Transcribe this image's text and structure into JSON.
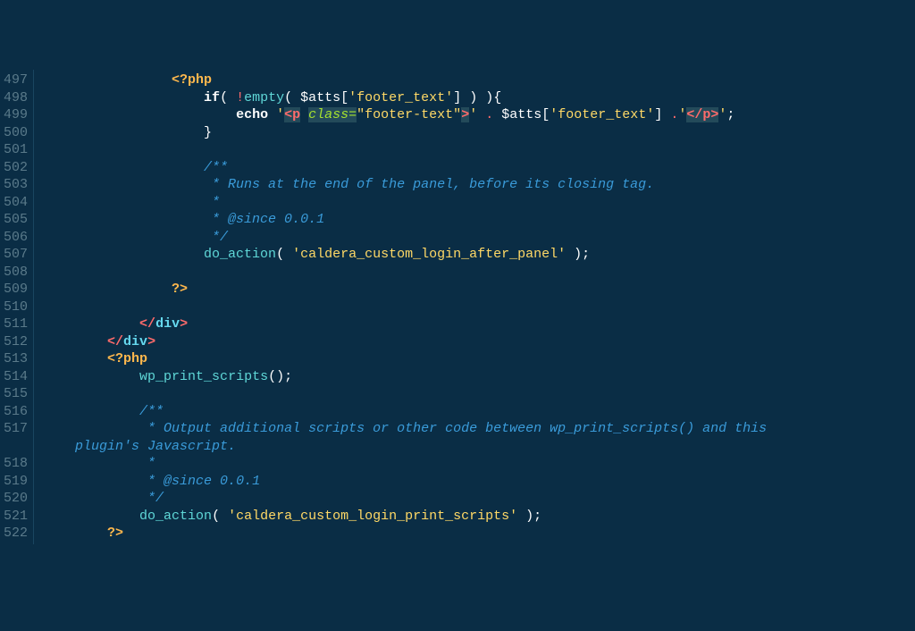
{
  "gutter": {
    "start": 497,
    "end": 522
  },
  "lines": {
    "l497": {
      "indent": "                ",
      "tokens": [
        {
          "cls": "php-tag",
          "t": "<?php"
        }
      ]
    },
    "l498": {
      "indent": "                    ",
      "tokens": [
        {
          "cls": "keyword",
          "t": "if"
        },
        {
          "cls": "paren",
          "t": "( "
        },
        {
          "cls": "op",
          "t": "!"
        },
        {
          "cls": "func",
          "t": "empty"
        },
        {
          "cls": "paren",
          "t": "( "
        },
        {
          "cls": "var",
          "t": "$atts"
        },
        {
          "cls": "bracket",
          "t": "["
        },
        {
          "cls": "string",
          "t": "'footer_text'"
        },
        {
          "cls": "bracket",
          "t": "]"
        },
        {
          "cls": "paren",
          "t": " ) )"
        },
        {
          "cls": "punct",
          "t": "{"
        }
      ]
    },
    "l499": {
      "indent": "                        ",
      "tokens": [
        {
          "cls": "keyword",
          "t": "echo"
        },
        {
          "cls": "",
          "t": " "
        },
        {
          "cls": "string",
          "t": "'"
        },
        {
          "cls": "tag-in-str",
          "t": "<p"
        },
        {
          "cls": "",
          "t": " "
        },
        {
          "cls": "attr-in-str",
          "t": "class="
        },
        {
          "cls": "val-in-str",
          "t": "\"footer-text\""
        },
        {
          "cls": "tag-in-str",
          "t": ">"
        },
        {
          "cls": "string",
          "t": "'"
        },
        {
          "cls": "",
          "t": " "
        },
        {
          "cls": "op",
          "t": "."
        },
        {
          "cls": "",
          "t": " "
        },
        {
          "cls": "var",
          "t": "$atts"
        },
        {
          "cls": "bracket",
          "t": "["
        },
        {
          "cls": "string",
          "t": "'footer_text'"
        },
        {
          "cls": "bracket",
          "t": "]"
        },
        {
          "cls": "",
          "t": " "
        },
        {
          "cls": "op",
          "t": "."
        },
        {
          "cls": "string",
          "t": "'"
        },
        {
          "cls": "tag-in-str",
          "t": "</p>"
        },
        {
          "cls": "string",
          "t": "'"
        },
        {
          "cls": "punct",
          "t": ";"
        }
      ]
    },
    "l500": {
      "indent": "                    ",
      "tokens": [
        {
          "cls": "punct",
          "t": "}"
        }
      ]
    },
    "l501": {
      "indent": "",
      "tokens": []
    },
    "l502": {
      "indent": "                    ",
      "tokens": [
        {
          "cls": "comment",
          "t": "/**"
        }
      ]
    },
    "l503": {
      "indent": "                     ",
      "tokens": [
        {
          "cls": "comment",
          "t": "* Runs at the end of the panel, before its closing tag."
        }
      ]
    },
    "l504": {
      "indent": "                     ",
      "tokens": [
        {
          "cls": "comment",
          "t": "*"
        }
      ]
    },
    "l505": {
      "indent": "                     ",
      "tokens": [
        {
          "cls": "comment",
          "t": "* @since 0.0.1"
        }
      ]
    },
    "l506": {
      "indent": "                     ",
      "tokens": [
        {
          "cls": "comment",
          "t": "*/"
        }
      ]
    },
    "l507": {
      "indent": "                    ",
      "tokens": [
        {
          "cls": "func",
          "t": "do_action"
        },
        {
          "cls": "paren",
          "t": "( "
        },
        {
          "cls": "string",
          "t": "'caldera_custom_login_after_panel'"
        },
        {
          "cls": "paren",
          "t": " )"
        },
        {
          "cls": "punct",
          "t": ";"
        }
      ]
    },
    "l508": {
      "indent": "",
      "tokens": []
    },
    "l509": {
      "indent": "                ",
      "tokens": [
        {
          "cls": "php-tag",
          "t": "?>"
        }
      ]
    },
    "l510": {
      "indent": "",
      "tokens": []
    },
    "l511": {
      "indent": "            ",
      "tokens": [
        {
          "cls": "tag",
          "t": "</"
        },
        {
          "cls": "tagname",
          "t": "div"
        },
        {
          "cls": "tag",
          "t": ">"
        }
      ]
    },
    "l512": {
      "indent": "        ",
      "tokens": [
        {
          "cls": "tag",
          "t": "</"
        },
        {
          "cls": "tagname",
          "t": "div"
        },
        {
          "cls": "tag",
          "t": ">"
        }
      ]
    },
    "l513": {
      "indent": "        ",
      "tokens": [
        {
          "cls": "php-tag",
          "t": "<?php"
        }
      ]
    },
    "l514": {
      "indent": "            ",
      "tokens": [
        {
          "cls": "func",
          "t": "wp_print_scripts"
        },
        {
          "cls": "paren",
          "t": "()"
        },
        {
          "cls": "punct",
          "t": ";"
        }
      ]
    },
    "l515": {
      "indent": "",
      "tokens": []
    },
    "l516": {
      "indent": "            ",
      "tokens": [
        {
          "cls": "comment",
          "t": "/**"
        }
      ]
    },
    "l517": {
      "indent": "             ",
      "tokens": [
        {
          "cls": "comment",
          "t": "* Output additional scripts or other code between wp_print_scripts() and this"
        }
      ]
    },
    "l517b": {
      "indent": "    ",
      "tokens": [
        {
          "cls": "comment",
          "t": "plugin's Javascript."
        }
      ]
    },
    "l518": {
      "indent": "             ",
      "tokens": [
        {
          "cls": "comment",
          "t": "*"
        }
      ]
    },
    "l519": {
      "indent": "             ",
      "tokens": [
        {
          "cls": "comment",
          "t": "* @since 0.0.1"
        }
      ]
    },
    "l520": {
      "indent": "             ",
      "tokens": [
        {
          "cls": "comment",
          "t": "*/"
        }
      ]
    },
    "l521": {
      "indent": "            ",
      "tokens": [
        {
          "cls": "func",
          "t": "do_action"
        },
        {
          "cls": "paren",
          "t": "( "
        },
        {
          "cls": "string",
          "t": "'caldera_custom_login_print_scripts'"
        },
        {
          "cls": "paren",
          "t": " )"
        },
        {
          "cls": "punct",
          "t": ";"
        }
      ]
    },
    "l522": {
      "indent": "        ",
      "tokens": [
        {
          "cls": "php-tag",
          "t": "?>"
        }
      ]
    }
  },
  "lineOrder": [
    "l497",
    "l498",
    "l499",
    "l500",
    "l501",
    "l502",
    "l503",
    "l504",
    "l505",
    "l506",
    "l507",
    "l508",
    "l509",
    "l510",
    "l511",
    "l512",
    "l513",
    "l514",
    "l515",
    "l516",
    "l517",
    "l517b",
    "l518",
    "l519",
    "l520",
    "l521",
    "l522"
  ],
  "gutterLabels": {
    "l497": "497",
    "l498": "498",
    "l499": "499",
    "l500": "500",
    "l501": "501",
    "l502": "502",
    "l503": "503",
    "l504": "504",
    "l505": "505",
    "l506": "506",
    "l507": "507",
    "l508": "508",
    "l509": "509",
    "l510": "510",
    "l511": "511",
    "l512": "512",
    "l513": "513",
    "l514": "514",
    "l515": "515",
    "l516": "516",
    "l517": "517",
    "l517b": "",
    "l518": "518",
    "l519": "519",
    "l520": "520",
    "l521": "521",
    "l522": "522"
  }
}
